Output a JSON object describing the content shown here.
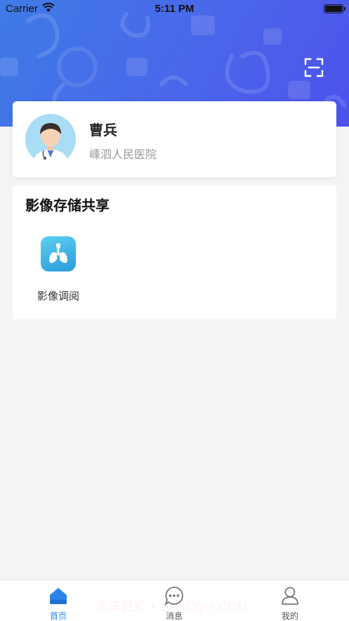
{
  "status_bar": {
    "carrier": "Carrier",
    "time": "5:11 PM"
  },
  "header": {
    "scan_icon": "scan-icon"
  },
  "profile": {
    "name": "曹兵",
    "hospital": "嵊泗人民医院",
    "avatar_icon": "doctor-avatar"
  },
  "section": {
    "title": "影像存储共享",
    "items": [
      {
        "label": "影像调阅",
        "icon": "lungs-icon"
      }
    ]
  },
  "tabbar": {
    "tabs": [
      {
        "label": "首页",
        "icon": "home-icon",
        "active": true
      },
      {
        "label": "消息",
        "icon": "message-icon",
        "active": false
      },
      {
        "label": "我的",
        "icon": "person-icon",
        "active": false
      }
    ]
  },
  "watermark": "乐享轻汇 • LXQCQH.COM",
  "colors": {
    "header_start": "#3f7be6",
    "header_end": "#4d52ec",
    "tab_active": "#2c84e8",
    "page_bg": "#f4f4f5"
  }
}
